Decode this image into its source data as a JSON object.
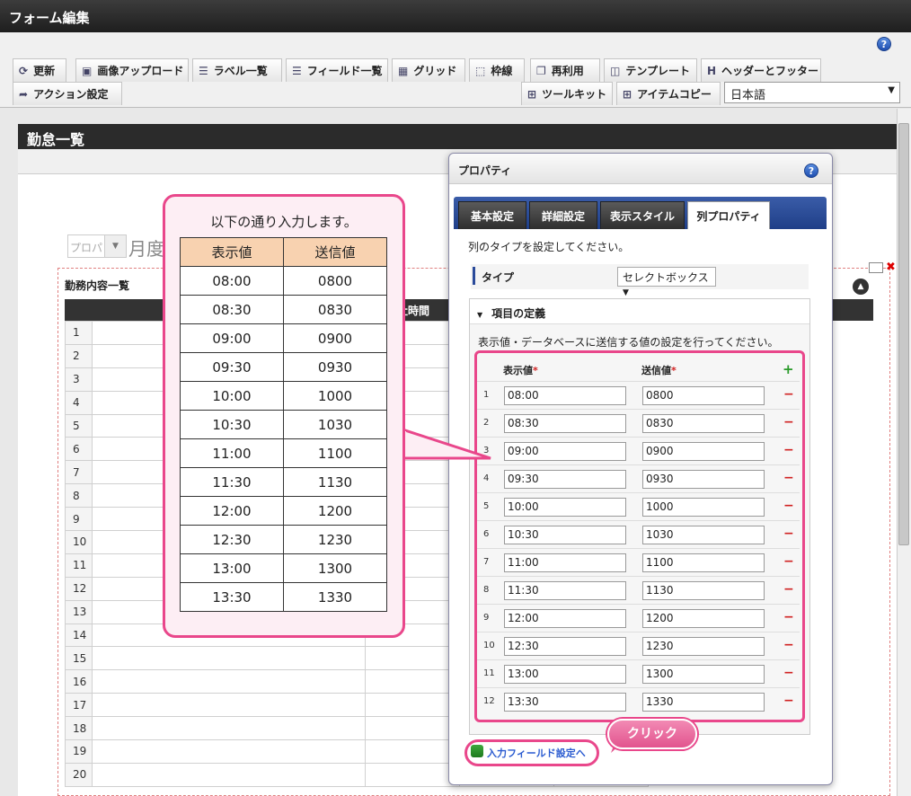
{
  "window": {
    "title": "フォーム編集"
  },
  "toolbar": {
    "row1": [
      {
        "label": "更新",
        "icon": "refresh-icon"
      },
      {
        "label": "画像アップロード",
        "icon": "image-upload-icon"
      },
      {
        "label": "ラベル一覧",
        "icon": "label-list-icon"
      },
      {
        "label": "フィールド一覧",
        "icon": "field-list-icon"
      },
      {
        "label": "グリッド",
        "icon": "grid-icon"
      },
      {
        "label": "枠線",
        "icon": "border-icon"
      },
      {
        "label": "再利用",
        "icon": "reuse-icon"
      },
      {
        "label": "テンプレート",
        "icon": "template-icon"
      },
      {
        "label": "ヘッダーとフッター",
        "icon": "header-footer-icon"
      }
    ],
    "row2": [
      {
        "label": "アクション設定",
        "icon": "action-icon"
      },
      {
        "label": "ツールキット",
        "icon": "toolkit-icon"
      },
      {
        "label": "アイテムコピー",
        "icon": "item-copy-icon"
      }
    ],
    "language": "日本語",
    "help": "?"
  },
  "form": {
    "title": "勤怠一覧",
    "year_placeholder": "プロパ",
    "month_label": "月度",
    "table_caption": "勤務内容一覧",
    "column_header": "出社時間",
    "row_numbers": [
      "1",
      "2",
      "3",
      "4",
      "5",
      "6",
      "7",
      "8",
      "9",
      "10",
      "11",
      "12",
      "13",
      "14",
      "15",
      "16",
      "17",
      "18",
      "19",
      "20"
    ]
  },
  "properties": {
    "title": "プロパティ",
    "help": "?",
    "tabs": [
      "基本設定",
      "詳細設定",
      "表示スタイル",
      "列プロパティ"
    ],
    "active_tab": "列プロパティ",
    "description": "列のタイプを設定してください。",
    "type_label": "タイプ",
    "type_value": "セレクトボックス",
    "section_title": "項目の定義",
    "section_description": "表示値・データベースに送信する値の設定を行ってください。",
    "col_display": "表示値",
    "col_send": "送信値",
    "required_mark": "*",
    "add_symbol": "+",
    "remove_symbol": "−",
    "rows": [
      {
        "no": "1",
        "display": "08:00",
        "send": "0800"
      },
      {
        "no": "2",
        "display": "08:30",
        "send": "0830"
      },
      {
        "no": "3",
        "display": "09:00",
        "send": "0900"
      },
      {
        "no": "4",
        "display": "09:30",
        "send": "0930"
      },
      {
        "no": "5",
        "display": "10:00",
        "send": "1000"
      },
      {
        "no": "6",
        "display": "10:30",
        "send": "1030"
      },
      {
        "no": "7",
        "display": "11:00",
        "send": "1100"
      },
      {
        "no": "8",
        "display": "11:30",
        "send": "1130"
      },
      {
        "no": "9",
        "display": "12:00",
        "send": "1200"
      },
      {
        "no": "10",
        "display": "12:30",
        "send": "1230"
      },
      {
        "no": "11",
        "display": "13:00",
        "send": "1300"
      },
      {
        "no": "12",
        "display": "13:30",
        "send": "1330"
      }
    ],
    "link_label": "入力フィールド設定へ"
  },
  "callout": {
    "title": "以下の通り入力します。",
    "col1": "表示値",
    "col2": "送信値",
    "rows": [
      [
        "08:00",
        "0800"
      ],
      [
        "08:30",
        "0830"
      ],
      [
        "09:00",
        "0900"
      ],
      [
        "09:30",
        "0930"
      ],
      [
        "10:00",
        "1000"
      ],
      [
        "10:30",
        "1030"
      ],
      [
        "11:00",
        "1100"
      ],
      [
        "11:30",
        "1130"
      ],
      [
        "12:00",
        "1200"
      ],
      [
        "12:30",
        "1230"
      ],
      [
        "13:00",
        "1300"
      ],
      [
        "13:30",
        "1330"
      ]
    ],
    "click_label": "クリック"
  },
  "colors": {
    "accent_pink": "#e9478b",
    "tab_blue": "#2a4a9a",
    "remove_red": "#d02020",
    "add_green": "#2a9a2a"
  }
}
